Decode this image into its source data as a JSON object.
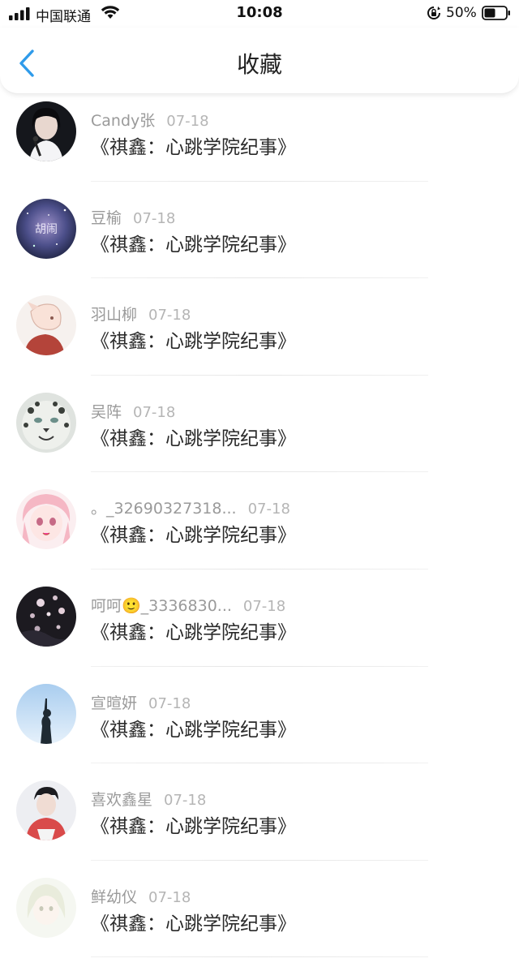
{
  "status": {
    "carrier": "中国联通",
    "time": "10:08",
    "battery_pct": "50%",
    "icons": [
      "signal-icon",
      "wifi-icon",
      "rotation-lock-icon",
      "battery-icon"
    ]
  },
  "nav": {
    "title": "收藏",
    "back_icon": "chevron-left-icon",
    "accent_color": "#2f9bea"
  },
  "items": [
    {
      "user": "Candy张",
      "date": "07-18",
      "book": "《祺鑫：心跳学院纪事》",
      "avatar": "avatar-girl-black-hair"
    },
    {
      "user": "豆榆",
      "date": "07-18",
      "book": "《祺鑫：心跳学院纪事》",
      "avatar": "avatar-galaxy",
      "avatar_text": "胡闹"
    },
    {
      "user": "羽山柳",
      "date": "07-18",
      "book": "《祺鑫：心跳学院纪事》",
      "avatar": "avatar-anime-pink"
    },
    {
      "user": "吴阵",
      "date": "07-18",
      "book": "《祺鑫：心跳学院纪事》",
      "avatar": "avatar-snow-leopard"
    },
    {
      "user": "。_32690327318...",
      "date": "07-18",
      "book": "《祺鑫：心跳学院纪事》",
      "avatar": "avatar-anime-girl"
    },
    {
      "user": "呵呵🙂_3336830...",
      "date": "07-18",
      "book": "《祺鑫：心跳学院纪事》",
      "avatar": "avatar-dark-flowers"
    },
    {
      "user": "宣暄妍",
      "date": "07-18",
      "book": "《祺鑫：心跳学院纪事》",
      "avatar": "avatar-silhouette-sky"
    },
    {
      "user": "喜欢鑫星",
      "date": "07-18",
      "book": "《祺鑫：心跳学院纪事》",
      "avatar": "avatar-boy"
    },
    {
      "user": "鲜幼仪",
      "date": "07-18",
      "book": "《祺鑫：心跳学院纪事》",
      "avatar": "avatar-light-anime"
    }
  ]
}
